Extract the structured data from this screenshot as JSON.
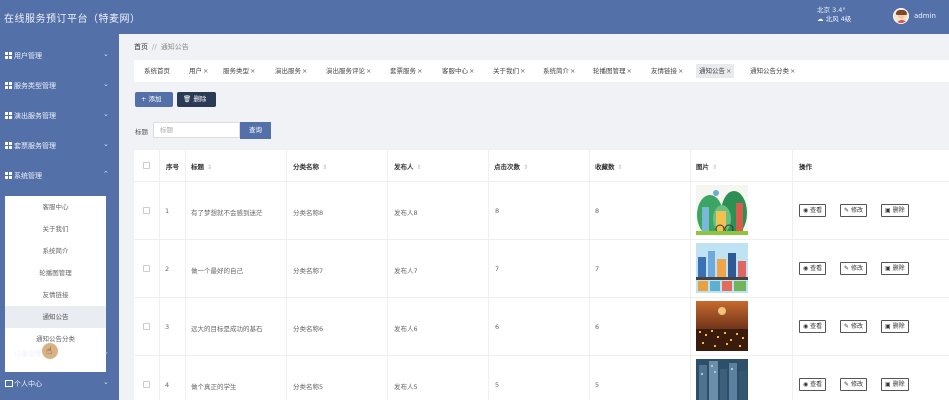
{
  "header": {
    "title": "在线服务预订平台（特麦网）",
    "weather_line1": "北京 3.4°",
    "weather_line2": "北风 4级",
    "weather_icon": "cloud-icon",
    "username": "admin"
  },
  "sidebar": {
    "items": [
      {
        "label": "用户管理",
        "arrow": "⌄"
      },
      {
        "label": "服务类型管理",
        "arrow": "⌄"
      },
      {
        "label": "演出服务管理",
        "arrow": "⌄"
      },
      {
        "label": "套票服务管理",
        "arrow": "⌄"
      },
      {
        "label": "系统管理",
        "arrow": "⌃"
      },
      {
        "label": "订单管理",
        "arrow": "⌄"
      },
      {
        "label": "个人中心",
        "arrow": "⌄"
      }
    ],
    "submenu": [
      "客服中心",
      "关于我们",
      "系统简介",
      "轮播图管理",
      "友情链接",
      "通知公告",
      "通知公告分类"
    ],
    "active_sub": "通知公告"
  },
  "breadcrumb": {
    "home": "首页",
    "sep": "//",
    "current": "通知公告"
  },
  "tabs": [
    {
      "label": "系统首页",
      "closable": false
    },
    {
      "label": "用户",
      "closable": true
    },
    {
      "label": "服务类型",
      "closable": true
    },
    {
      "label": "演出服务",
      "closable": true
    },
    {
      "label": "演出服务评论",
      "closable": true
    },
    {
      "label": "套票服务",
      "closable": true
    },
    {
      "label": "客服中心",
      "closable": true
    },
    {
      "label": "关于我们",
      "closable": true
    },
    {
      "label": "系统简介",
      "closable": true
    },
    {
      "label": "轮播图管理",
      "closable": true
    },
    {
      "label": "友情链接",
      "closable": true
    },
    {
      "label": "通知公告",
      "closable": true,
      "active": true
    },
    {
      "label": "通知公告分类",
      "closable": true
    }
  ],
  "toolbar": {
    "add_label": "+ 添加",
    "delete_label": "删除"
  },
  "search": {
    "label": "标题",
    "placeholder": "标题",
    "button": "查询"
  },
  "table": {
    "columns": [
      "序号",
      "标题",
      "分类名称",
      "发布人",
      "点击次数",
      "收藏数",
      "图片",
      "操作"
    ],
    "sortable": [
      false,
      true,
      true,
      true,
      true,
      true,
      true,
      false
    ],
    "rows": [
      {
        "no": "1",
        "title": "有了梦想就不会感到迷茫",
        "category": "分类名称8",
        "publisher": "发布人8",
        "clicks": "8",
        "favorites": "8",
        "image": "green-city-illustration"
      },
      {
        "no": "2",
        "title": "做一个最好的自己",
        "category": "分类名称7",
        "publisher": "发布人7",
        "clicks": "7",
        "favorites": "7",
        "image": "blue-city-illustration"
      },
      {
        "no": "3",
        "title": "远大的目标是成功的基石",
        "category": "分类名称6",
        "publisher": "发布人6",
        "clicks": "6",
        "favorites": "6",
        "image": "city-night-photo"
      },
      {
        "no": "4",
        "title": "做个真正的学生",
        "category": "分类名称5",
        "publisher": "发布人5",
        "clicks": "5",
        "favorites": "5",
        "image": "city-skyline-photo"
      }
    ],
    "actions": {
      "view": "查看",
      "edit": "修改",
      "delete": "删除"
    }
  },
  "colors": {
    "primary": "#5470a8",
    "dark_button": "#2b3a55",
    "background": "#f0f2f5"
  }
}
